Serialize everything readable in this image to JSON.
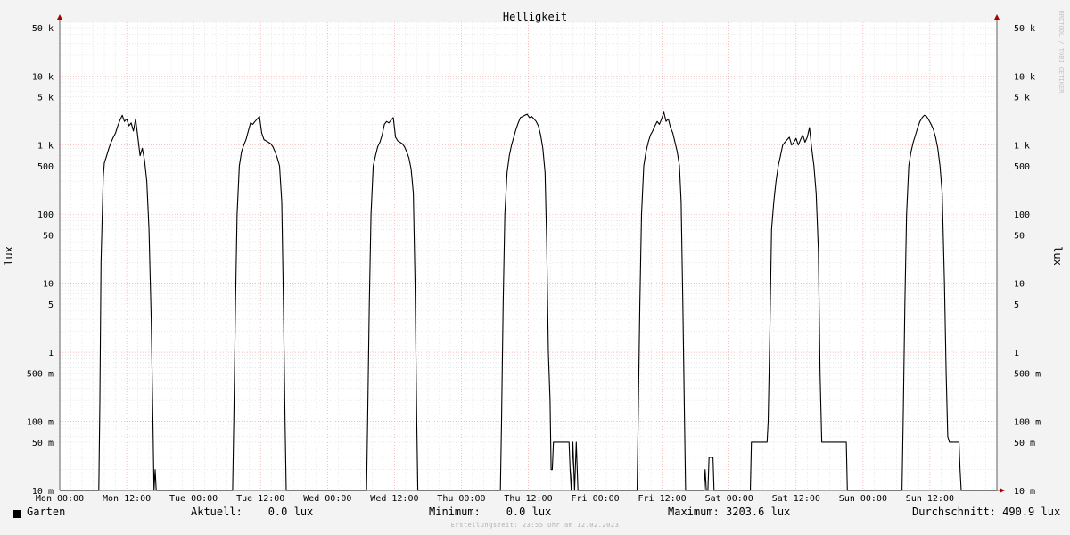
{
  "chart_data": {
    "type": "line",
    "title": "Helligkeit",
    "ylabel": "lux",
    "ylabel_right": "lux",
    "watermark": "RRDTOOL / TOBI OETIKER",
    "y_scale": "log",
    "ylim": [
      0.01,
      60000
    ],
    "xlim": [
      0,
      168
    ],
    "x_unit": "hours since Mon 00:00",
    "grid": true,
    "x_ticks": [
      {
        "x": 0,
        "label": "Mon 00:00"
      },
      {
        "x": 12,
        "label": "Mon 12:00"
      },
      {
        "x": 24,
        "label": "Tue 00:00"
      },
      {
        "x": 36,
        "label": "Tue 12:00"
      },
      {
        "x": 48,
        "label": "Wed 00:00"
      },
      {
        "x": 60,
        "label": "Wed 12:00"
      },
      {
        "x": 72,
        "label": "Thu 00:00"
      },
      {
        "x": 84,
        "label": "Thu 12:00"
      },
      {
        "x": 96,
        "label": "Fri 00:00"
      },
      {
        "x": 108,
        "label": "Fri 12:00"
      },
      {
        "x": 120,
        "label": "Sat 00:00"
      },
      {
        "x": 132,
        "label": "Sat 12:00"
      },
      {
        "x": 144,
        "label": "Sun 00:00"
      },
      {
        "x": 156,
        "label": "Sun 12:00"
      }
    ],
    "y_ticks": [
      {
        "y": 50000,
        "label": "50 k"
      },
      {
        "y": 10000,
        "label": "10 k"
      },
      {
        "y": 5000,
        "label": "5 k"
      },
      {
        "y": 1000,
        "label": "1 k"
      },
      {
        "y": 500,
        "label": "500"
      },
      {
        "y": 100,
        "label": "100"
      },
      {
        "y": 50,
        "label": "50"
      },
      {
        "y": 10,
        "label": "10"
      },
      {
        "y": 5,
        "label": "5"
      },
      {
        "y": 1,
        "label": "1"
      },
      {
        "y": 0.5,
        "label": "500 m"
      },
      {
        "y": 0.1,
        "label": "100 m"
      },
      {
        "y": 0.05,
        "label": "50 m"
      },
      {
        "y": 0.01,
        "label": "10 m"
      }
    ],
    "series": [
      {
        "name": "Garten",
        "color": "#000000",
        "points": [
          [
            0,
            0.01
          ],
          [
            7,
            0.01
          ],
          [
            7.2,
            0.2
          ],
          [
            7.4,
            20
          ],
          [
            7.6,
            80
          ],
          [
            7.8,
            350
          ],
          [
            8,
            550
          ],
          [
            8.4,
            700
          ],
          [
            8.8,
            900
          ],
          [
            9.2,
            1100
          ],
          [
            9.6,
            1300
          ],
          [
            10,
            1500
          ],
          [
            10.4,
            1900
          ],
          [
            10.8,
            2300
          ],
          [
            11.2,
            2700
          ],
          [
            11.6,
            2200
          ],
          [
            12,
            2400
          ],
          [
            12.4,
            1900
          ],
          [
            12.8,
            2100
          ],
          [
            13.2,
            1600
          ],
          [
            13.6,
            2400
          ],
          [
            14,
            1300
          ],
          [
            14.4,
            700
          ],
          [
            14.8,
            900
          ],
          [
            15.2,
            600
          ],
          [
            15.6,
            300
          ],
          [
            16,
            60
          ],
          [
            16.4,
            3
          ],
          [
            16.7,
            0.1
          ],
          [
            16.9,
            0.01
          ],
          [
            17.1,
            0.02
          ],
          [
            17.3,
            0.01
          ],
          [
            31,
            0.01
          ],
          [
            31.2,
            0.1
          ],
          [
            31.5,
            5
          ],
          [
            31.8,
            100
          ],
          [
            32.2,
            500
          ],
          [
            32.6,
            800
          ],
          [
            33,
            1000
          ],
          [
            33.4,
            1200
          ],
          [
            33.8,
            1600
          ],
          [
            34.2,
            2100
          ],
          [
            34.6,
            2000
          ],
          [
            35,
            2200
          ],
          [
            35.4,
            2400
          ],
          [
            35.8,
            2600
          ],
          [
            36.2,
            1500
          ],
          [
            36.6,
            1200
          ],
          [
            37,
            1150
          ],
          [
            37.4,
            1100
          ],
          [
            37.8,
            1050
          ],
          [
            38.2,
            950
          ],
          [
            38.6,
            800
          ],
          [
            39,
            650
          ],
          [
            39.4,
            500
          ],
          [
            39.8,
            150
          ],
          [
            40.1,
            5
          ],
          [
            40.4,
            0.1
          ],
          [
            40.6,
            0.01
          ],
          [
            55,
            0.01
          ],
          [
            55.2,
            0.1
          ],
          [
            55.5,
            5
          ],
          [
            55.8,
            100
          ],
          [
            56.2,
            500
          ],
          [
            56.6,
            700
          ],
          [
            57,
            950
          ],
          [
            57.4,
            1100
          ],
          [
            57.8,
            1400
          ],
          [
            58.2,
            2000
          ],
          [
            58.6,
            2200
          ],
          [
            59,
            2100
          ],
          [
            59.4,
            2300
          ],
          [
            59.8,
            2500
          ],
          [
            60.2,
            1300
          ],
          [
            60.6,
            1150
          ],
          [
            61,
            1100
          ],
          [
            61.4,
            1050
          ],
          [
            61.8,
            950
          ],
          [
            62.2,
            800
          ],
          [
            62.6,
            650
          ],
          [
            63,
            450
          ],
          [
            63.4,
            200
          ],
          [
            63.7,
            10
          ],
          [
            64,
            0.1
          ],
          [
            64.2,
            0.01
          ],
          [
            79,
            0.01
          ],
          [
            79.2,
            0.1
          ],
          [
            79.5,
            5
          ],
          [
            79.8,
            100
          ],
          [
            80.2,
            400
          ],
          [
            80.6,
            700
          ],
          [
            81,
            1000
          ],
          [
            81.4,
            1300
          ],
          [
            81.8,
            1700
          ],
          [
            82.2,
            2100
          ],
          [
            82.6,
            2500
          ],
          [
            83,
            2600
          ],
          [
            83.4,
            2700
          ],
          [
            83.8,
            2800
          ],
          [
            84.2,
            2500
          ],
          [
            84.6,
            2600
          ],
          [
            85,
            2400
          ],
          [
            85.4,
            2200
          ],
          [
            85.8,
            1900
          ],
          [
            86.2,
            1400
          ],
          [
            86.6,
            900
          ],
          [
            87,
            400
          ],
          [
            87.3,
            40
          ],
          [
            87.6,
            1
          ],
          [
            87.9,
            0.2
          ],
          [
            88.1,
            0.02
          ],
          [
            88.3,
            0.02
          ],
          [
            88.5,
            0.05
          ],
          [
            91.3,
            0.05
          ],
          [
            91.5,
            0.02
          ],
          [
            91.7,
            0.01
          ],
          [
            92,
            0.05
          ],
          [
            92.3,
            0.01
          ],
          [
            92.6,
            0.05
          ],
          [
            92.9,
            0.01
          ],
          [
            93.2,
            0.01
          ],
          [
            103.5,
            0.01
          ],
          [
            103.7,
            0.1
          ],
          [
            104,
            5
          ],
          [
            104.3,
            100
          ],
          [
            104.7,
            500
          ],
          [
            105.1,
            800
          ],
          [
            105.5,
            1100
          ],
          [
            105.9,
            1400
          ],
          [
            106.3,
            1600
          ],
          [
            106.7,
            1900
          ],
          [
            107.1,
            2200
          ],
          [
            107.5,
            2000
          ],
          [
            107.9,
            2400
          ],
          [
            108.3,
            3000
          ],
          [
            108.7,
            2200
          ],
          [
            109.1,
            2400
          ],
          [
            109.5,
            1800
          ],
          [
            109.9,
            1500
          ],
          [
            110.3,
            1100
          ],
          [
            110.7,
            800
          ],
          [
            111.1,
            500
          ],
          [
            111.4,
            150
          ],
          [
            111.7,
            5
          ],
          [
            112,
            0.1
          ],
          [
            112.2,
            0.01
          ],
          [
            115.5,
            0.01
          ],
          [
            115.7,
            0.02
          ],
          [
            115.9,
            0.01
          ],
          [
            116.2,
            0.01
          ],
          [
            116.4,
            0.03
          ],
          [
            117.1,
            0.03
          ],
          [
            117.3,
            0.01
          ],
          [
            123.8,
            0.01
          ],
          [
            124,
            0.05
          ],
          [
            126.8,
            0.05
          ],
          [
            127,
            0.1
          ],
          [
            127.3,
            2
          ],
          [
            127.6,
            60
          ],
          [
            128,
            150
          ],
          [
            128.4,
            300
          ],
          [
            128.8,
            500
          ],
          [
            129.2,
            700
          ],
          [
            129.6,
            1000
          ],
          [
            130,
            1100
          ],
          [
            130.4,
            1200
          ],
          [
            130.8,
            1300
          ],
          [
            131.2,
            1000
          ],
          [
            131.6,
            1100
          ],
          [
            132,
            1250
          ],
          [
            132.4,
            1000
          ],
          [
            132.8,
            1200
          ],
          [
            133.2,
            1400
          ],
          [
            133.6,
            1100
          ],
          [
            134,
            1300
          ],
          [
            134.4,
            1800
          ],
          [
            134.8,
            900
          ],
          [
            135.2,
            500
          ],
          [
            135.6,
            200
          ],
          [
            136,
            30
          ],
          [
            136.3,
            0.5
          ],
          [
            136.6,
            0.05
          ],
          [
            141,
            0.05
          ],
          [
            141.2,
            0.01
          ],
          [
            151,
            0.01
          ],
          [
            151.2,
            0.1
          ],
          [
            151.5,
            5
          ],
          [
            151.8,
            100
          ],
          [
            152.2,
            500
          ],
          [
            152.6,
            800
          ],
          [
            153,
            1100
          ],
          [
            153.4,
            1400
          ],
          [
            153.8,
            1800
          ],
          [
            154.2,
            2200
          ],
          [
            154.6,
            2500
          ],
          [
            155,
            2700
          ],
          [
            155.4,
            2600
          ],
          [
            155.8,
            2300
          ],
          [
            156.2,
            2000
          ],
          [
            156.6,
            1700
          ],
          [
            157,
            1300
          ],
          [
            157.4,
            900
          ],
          [
            157.8,
            500
          ],
          [
            158.2,
            200
          ],
          [
            158.6,
            10
          ],
          [
            158.9,
            0.5
          ],
          [
            159.2,
            0.06
          ],
          [
            159.5,
            0.05
          ],
          [
            161.2,
            0.05
          ],
          [
            161.4,
            0.02
          ],
          [
            161.6,
            0.01
          ],
          [
            168,
            0.01
          ]
        ]
      }
    ]
  },
  "legend": {
    "series_label": "Garten",
    "current": "Aktuell:    0.0 lux",
    "minimum": "Minimum:    0.0 lux",
    "maximum": "Maximum: 3203.6 lux",
    "average": "Durchschnitt: 490.9 lux"
  },
  "footer": "Erstellungszeit: 23:55 Uhr am 12.02.2023",
  "colors": {
    "background": "#f3f3f3",
    "plot_background": "#ffffff",
    "minor_grid": "#dcdcdc",
    "major_grid": "#f0a8a8",
    "axis": "#606060",
    "arrow": "#aa0000",
    "line": "#000000"
  }
}
